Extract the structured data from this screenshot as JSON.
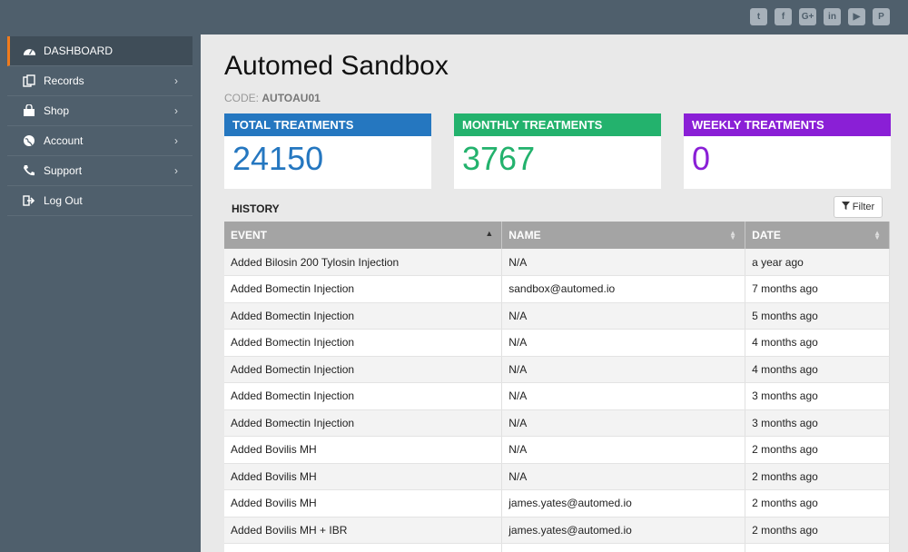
{
  "social": [
    "twitter-icon",
    "facebook-icon",
    "google-plus-icon",
    "linkedin-icon",
    "youtube-icon",
    "pinterest-icon"
  ],
  "social_glyphs": [
    "t",
    "f",
    "G+",
    "in",
    "▶",
    "P"
  ],
  "sidebar": {
    "items": [
      {
        "label": "DASHBOARD",
        "icon": "dashboard-icon",
        "active": true
      },
      {
        "label": "Records",
        "icon": "records-icon"
      },
      {
        "label": "Shop",
        "icon": "shop-icon"
      },
      {
        "label": "Account",
        "icon": "globe-icon"
      },
      {
        "label": "Support",
        "icon": "phone-icon"
      },
      {
        "label": "Log Out",
        "icon": "logout-icon"
      }
    ]
  },
  "main": {
    "title": "Automed Sandbox",
    "code_label": "CODE:",
    "code_value": "AUTOAU01",
    "cards": [
      {
        "label": "TOTAL TREATMENTS",
        "value": "24150",
        "color": "#2577c0"
      },
      {
        "label": "MONTHLY TREATMENTS",
        "value": "3767",
        "color": "#23b26d"
      },
      {
        "label": "WEEKLY TREATMENTS",
        "value": "0",
        "color": "#8a1fd6"
      }
    ],
    "history_label": "HISTORY",
    "filter_label": "Filter",
    "table": {
      "headers": [
        "EVENT",
        "NAME",
        "DATE"
      ],
      "rows": [
        [
          "Added Bilosin 200 Tylosin Injection",
          "N/A",
          "a year ago"
        ],
        [
          "Added Bomectin Injection",
          "sandbox@automed.io",
          "7 months ago"
        ],
        [
          "Added Bomectin Injection",
          "N/A",
          "5 months ago"
        ],
        [
          "Added Bomectin Injection",
          "N/A",
          "4 months ago"
        ],
        [
          "Added Bomectin Injection",
          "N/A",
          "4 months ago"
        ],
        [
          "Added Bomectin Injection",
          "N/A",
          "3 months ago"
        ],
        [
          "Added Bomectin Injection",
          "N/A",
          "3 months ago"
        ],
        [
          "Added Bovilis MH",
          "N/A",
          "2 months ago"
        ],
        [
          "Added Bovilis MH",
          "N/A",
          "2 months ago"
        ],
        [
          "Added Bovilis MH",
          "james.yates@automed.io",
          "2 months ago"
        ],
        [
          "Added Bovilis MH + IBR",
          "james.yates@automed.io",
          "2 months ago"
        ],
        [
          "",
          "",
          ""
        ]
      ]
    }
  }
}
